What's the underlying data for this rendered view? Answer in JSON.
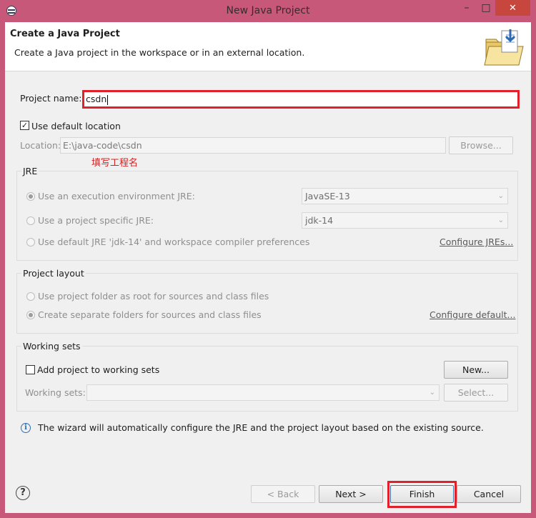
{
  "window": {
    "title": "New Java Project"
  },
  "banner": {
    "title": "Create a Java Project",
    "description": "Create a Java project in the workspace or in an external location."
  },
  "project_name": {
    "label": "Project name:",
    "value": "csdn"
  },
  "use_default_location": {
    "label": "Use default location",
    "checked": true
  },
  "location": {
    "label": "Location:",
    "value": "E:\\java-code\\csdn",
    "browse_label": "Browse..."
  },
  "annotation": "填写工程名",
  "jre": {
    "group_title": "JRE",
    "option_env_label": "Use an execution environment JRE:",
    "option_env_value": "JavaSE-13",
    "option_specific_label": "Use a project specific JRE:",
    "option_specific_value": "jdk-14",
    "option_default_label": "Use default JRE 'jdk-14' and workspace compiler preferences",
    "configure_link": "Configure JREs...",
    "selected": "execution-environment"
  },
  "project_layout": {
    "group_title": "Project layout",
    "option_root_label": "Use project folder as root for sources and class files",
    "option_separate_label": "Create separate folders for sources and class files",
    "configure_link": "Configure default...",
    "selected": "separate"
  },
  "working_sets": {
    "group_title": "Working sets",
    "add_label": "Add project to working sets",
    "add_checked": false,
    "new_button": "New...",
    "field_label": "Working sets:",
    "field_value": "",
    "select_button": "Select..."
  },
  "info_message": "The wizard will automatically configure the JRE and the project layout based on the existing source.",
  "buttons": {
    "back": "< Back",
    "next": "Next >",
    "finish": "Finish",
    "cancel": "Cancel"
  },
  "icons": {
    "app": "eclipse-icon",
    "banner": "new-java-project-folder-icon",
    "info": "info-icon",
    "help": "help-icon",
    "close": "close-icon"
  },
  "colors": {
    "title_bar": "#c8587a",
    "highlight": "#e0202a",
    "annotation": "#d62020"
  }
}
